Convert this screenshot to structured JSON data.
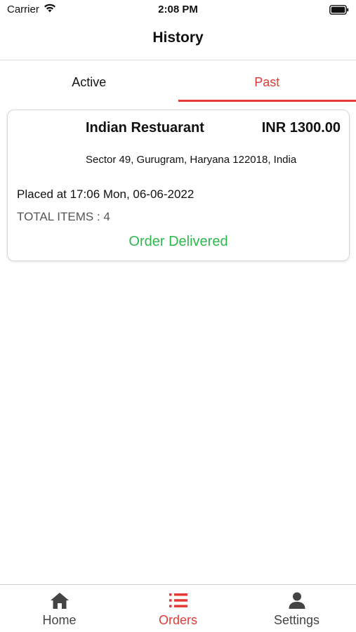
{
  "status_bar": {
    "carrier": "Carrier",
    "time": "2:08 PM"
  },
  "header": {
    "title": "History"
  },
  "tabs": [
    {
      "label": "Active",
      "selected": false
    },
    {
      "label": "Past",
      "selected": true
    }
  ],
  "orders": [
    {
      "restaurant": "Indian Restuarant",
      "amount": "INR 1300.00",
      "address": "Sector 49, Gurugram, Haryana 122018, India",
      "placed_at": "Placed at 17:06 Mon, 06-06-2022",
      "total_items": "TOTAL ITEMS : 4",
      "status": "Order Delivered"
    }
  ],
  "tab_bar": {
    "items": [
      {
        "label": "Home",
        "icon": "home-icon",
        "selected": false
      },
      {
        "label": "Orders",
        "icon": "list-icon",
        "selected": true
      },
      {
        "label": "Settings",
        "icon": "person-icon",
        "selected": false
      }
    ]
  },
  "colors": {
    "accent": "#e53935",
    "success": "#2db84d",
    "inactive": "#444444"
  }
}
